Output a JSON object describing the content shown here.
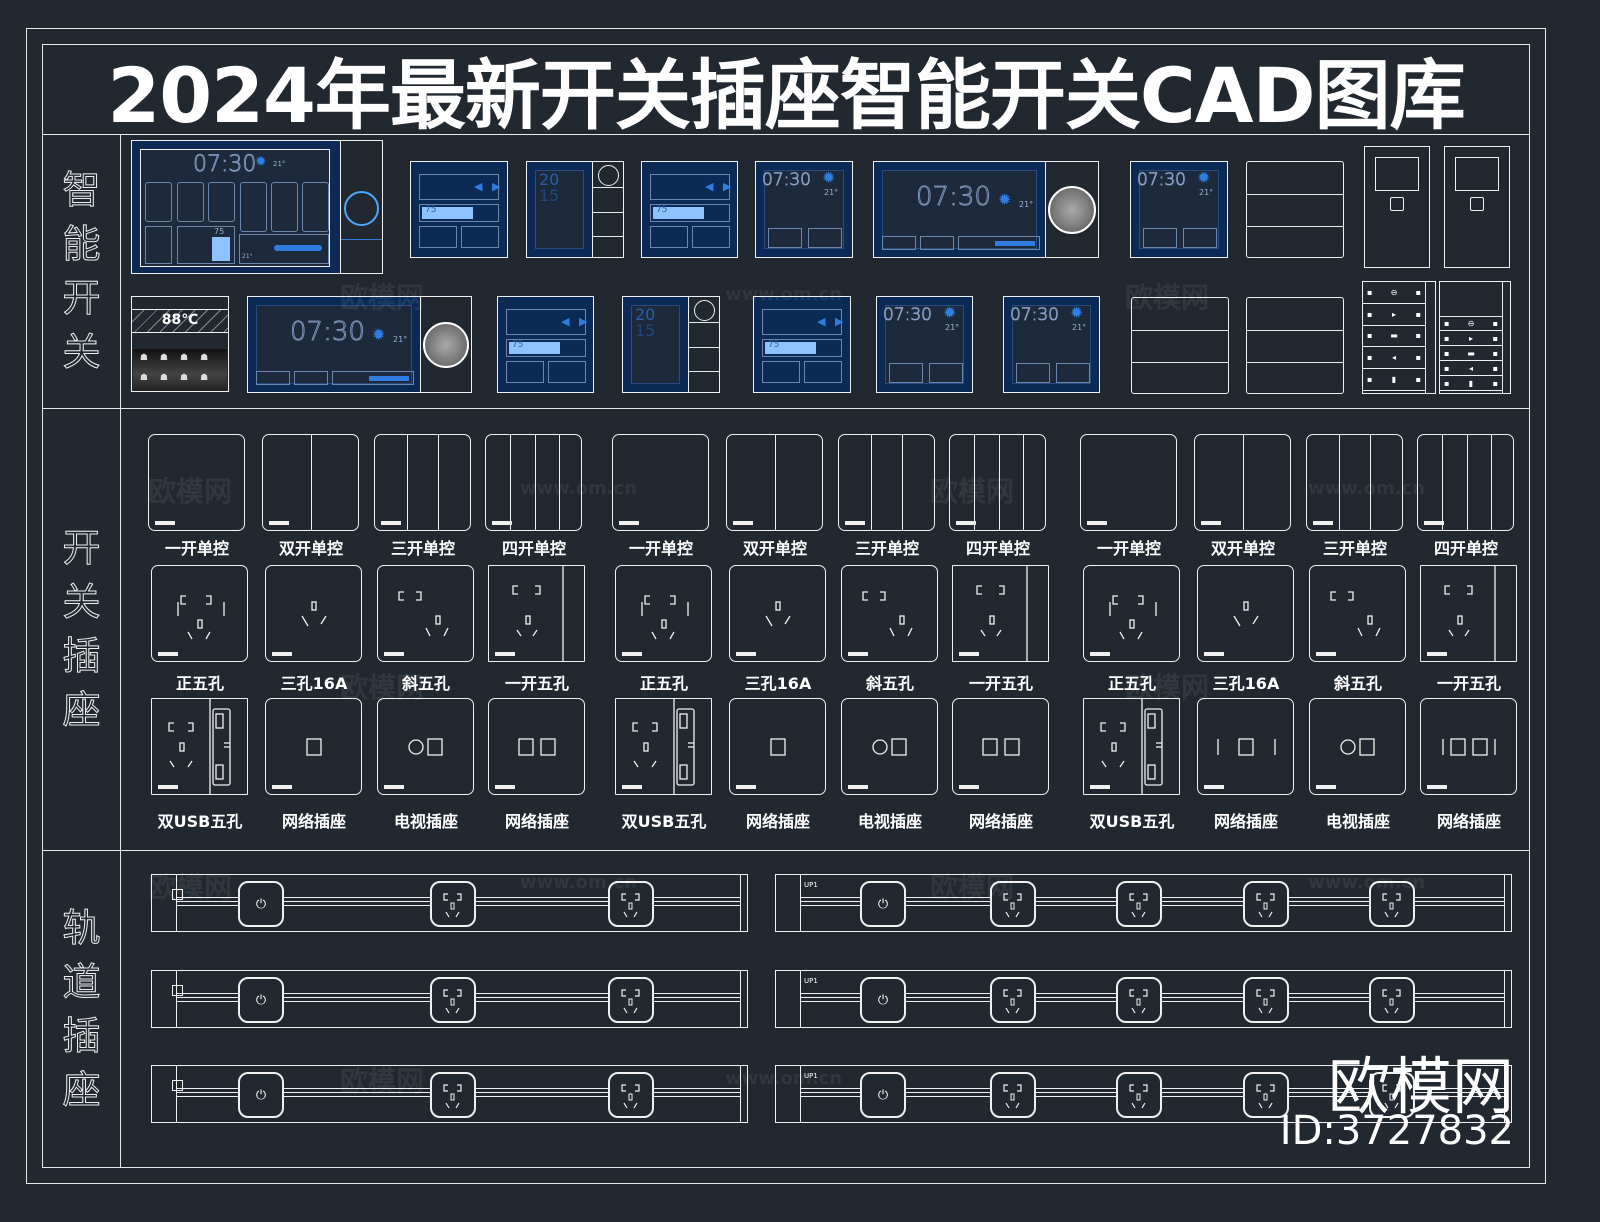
{
  "title": "2024年最新开关插座智能开关CAD图库",
  "sections": {
    "smart": "智能开关",
    "switch_socket": "开关插座",
    "rail": "轨道插座"
  },
  "colors": {
    "background": "#212830",
    "line": "#f0f0f0",
    "panel_blue": "#0b2a55",
    "accent_blue": "#2f7de0",
    "bar_fill": "#8fc3ff"
  },
  "smart_panels": {
    "clock_text": "07:30",
    "temp_text": "21°",
    "date_top": "20",
    "date_bottom": "15",
    "progress_label": "75",
    "progress_value": 0.75,
    "thermostat_text": "88℃"
  },
  "switch_groups": [
    {
      "row1": [
        "一开单控",
        "双开单控",
        "三开单控",
        "四开单控"
      ],
      "row2": [
        "正五孔",
        "三孔16A",
        "斜五孔",
        "一开五孔"
      ],
      "row3": [
        "双USB五孔",
        "网络插座",
        "电视插座",
        "网络插座"
      ]
    },
    {
      "row1": [
        "一开单控",
        "双开单控",
        "三开单控",
        "四开单控"
      ],
      "row2": [
        "正五孔",
        "三孔16A",
        "斜五孔",
        "一开五孔"
      ],
      "row3": [
        "双USB五孔",
        "网络插座",
        "电视插座",
        "网络插座"
      ]
    },
    {
      "row1": [
        "一开单控",
        "双开单控",
        "三开单控",
        "四开单控"
      ],
      "row2": [
        "正五孔",
        "三孔16A",
        "斜五孔",
        "一开五孔"
      ],
      "row3": [
        "双USB五孔",
        "网络插座",
        "电视插座",
        "网络插座"
      ]
    }
  ],
  "rail": {
    "tag": "UP1",
    "power_glyph": "⏻"
  },
  "watermark": {
    "cn": "欧模网",
    "url": "www.om.cn",
    "brand": "欧模网",
    "id": "ID:3727832"
  }
}
